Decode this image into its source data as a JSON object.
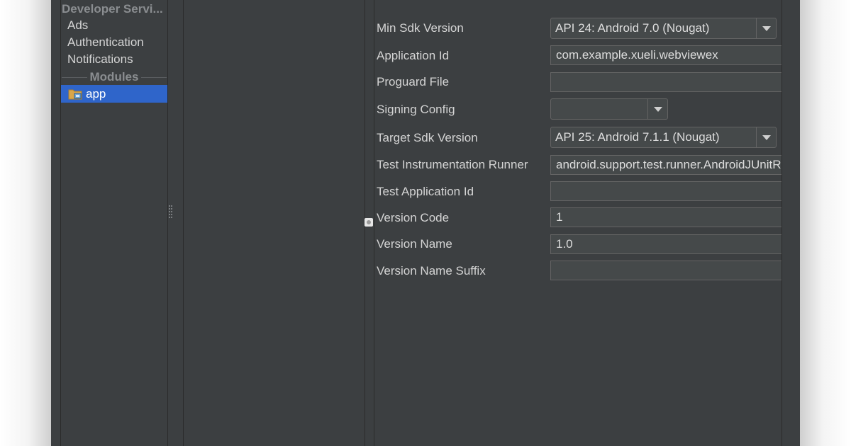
{
  "sidebar": {
    "section_header": "Developer Servi...",
    "items": [
      "Ads",
      "Authentication",
      "Notifications"
    ],
    "modules_header": "Modules",
    "modules": [
      {
        "label": "app",
        "icon": "folder-module-icon",
        "selected": true
      }
    ]
  },
  "properties": {
    "min_sdk": {
      "label": "Min Sdk Version",
      "value": "API 24: Android 7.0 (Nougat)"
    },
    "application_id": {
      "label": "Application Id",
      "value": "com.example.xueli.webviewex"
    },
    "proguard_file": {
      "label": "Proguard File",
      "value": ""
    },
    "signing_config": {
      "label": "Signing Config",
      "value": ""
    },
    "target_sdk": {
      "label": "Target Sdk Version",
      "value": "API 25: Android 7.1.1 (Nougat)"
    },
    "test_runner": {
      "label": "Test Instrumentation Runner",
      "value": "android.support.test.runner.AndroidJUnitRunner"
    },
    "test_app_id": {
      "label": "Test Application Id",
      "value": ""
    },
    "version_code": {
      "label": "Version Code",
      "value": "1"
    },
    "version_name": {
      "label": "Version Name",
      "value": "1.0"
    },
    "version_name_suffix": {
      "label": "Version Name Suffix",
      "value": ""
    }
  },
  "colors": {
    "background": "#3c3f41",
    "selection": "#2f65ca",
    "field_bg": "#45494a",
    "text": "#d4d4d4"
  }
}
